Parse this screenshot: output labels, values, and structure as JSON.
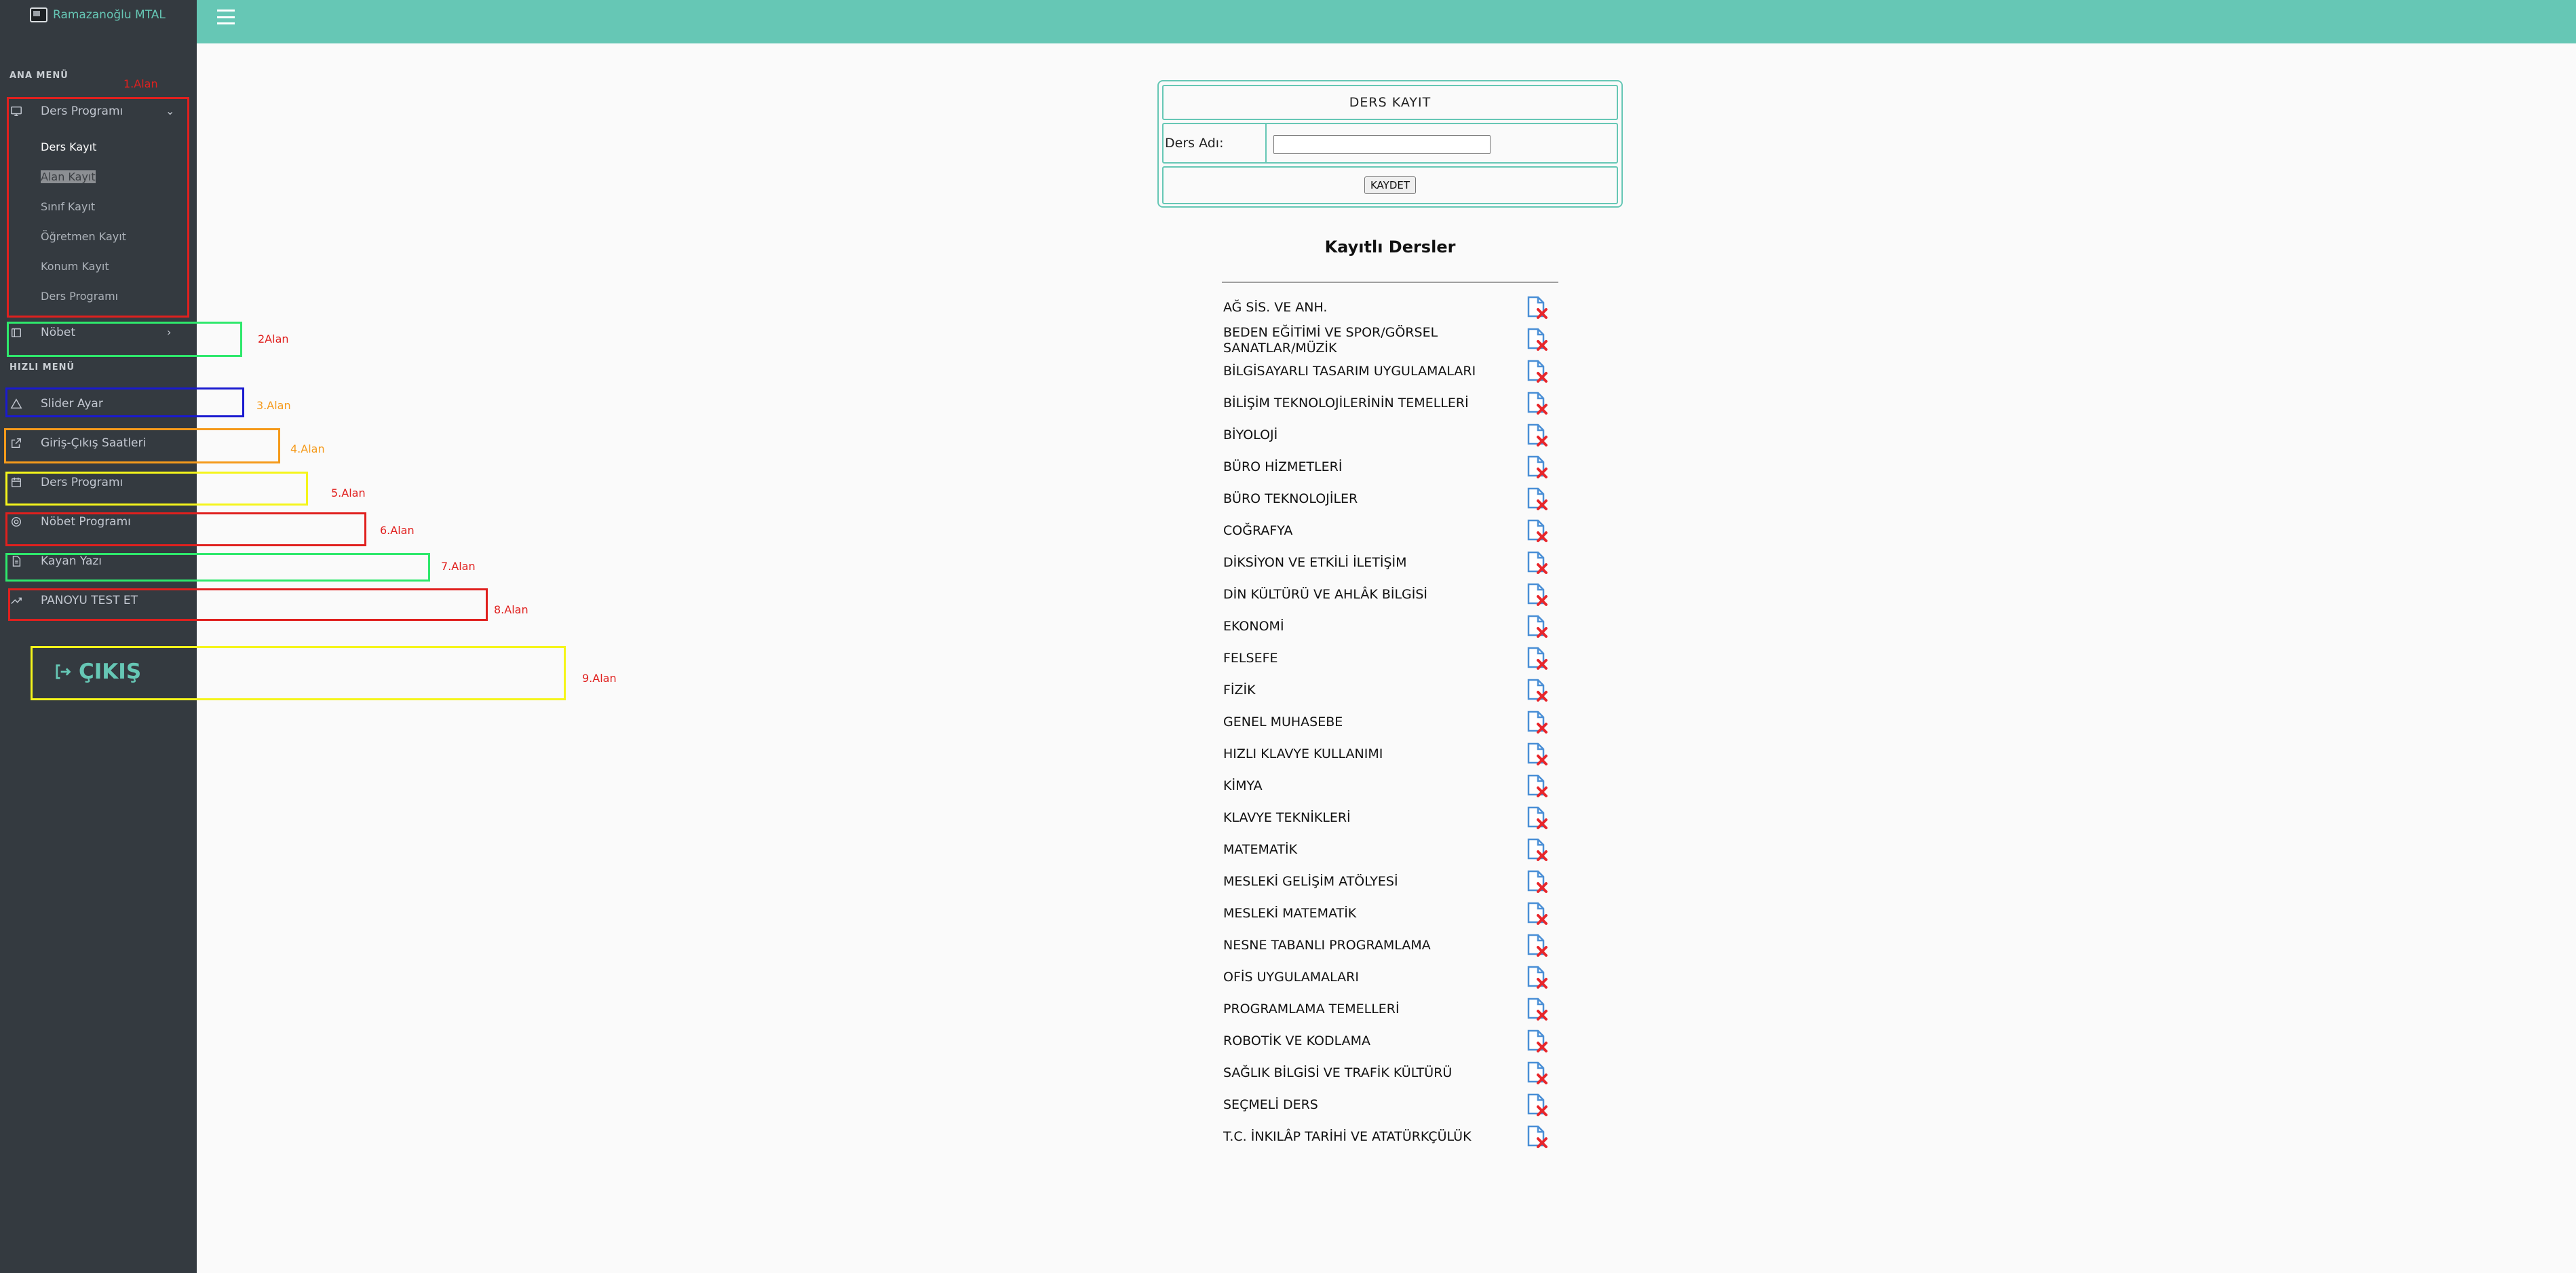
{
  "app": {
    "brand": "Ramazanoğlu MTAL"
  },
  "sidebar": {
    "main_menu_header": "ANA MENÜ",
    "quick_menu_header": "HIZLI MENÜ",
    "ders_programi": {
      "label": "Ders Programı",
      "sub_items": [
        "Ders Kayıt",
        "Alan Kayıt",
        "Sınıf Kayıt",
        "Öğretmen Kayıt",
        "Konum Kayıt",
        "Ders Programı"
      ]
    },
    "nobet": {
      "label": "Nöbet"
    },
    "quick_items": [
      "Slider Ayar",
      "Giriş-Çıkış Saatleri",
      "Ders Programı",
      "Nöbet Programı",
      "Kayan Yazı",
      "PANOYU TEST ET"
    ],
    "logout_label": "ÇIKIŞ"
  },
  "annotations": [
    {
      "label": "1.Alan",
      "color": "#e0201e"
    },
    {
      "label": "2Alan",
      "color": "#2ee86c"
    },
    {
      "label": "3.Alan",
      "color": "#1a1ad0"
    },
    {
      "label": "4.Alan",
      "color": "#f59a1b"
    },
    {
      "label": "5.Alan",
      "color": "#f5f51b"
    },
    {
      "label": "6.Alan",
      "color": "#e0201e"
    },
    {
      "label": "7.Alan",
      "color": "#2ee86c"
    },
    {
      "label": "8.Alan",
      "color": "#e0201e"
    },
    {
      "label": "9.Alan",
      "color": "#f5f51b"
    }
  ],
  "form": {
    "title": "DERS KAYIT",
    "field_label": "Ders Adı:",
    "field_value": "",
    "submit_label": "KAYDET"
  },
  "list": {
    "heading": "Kayıtlı Dersler",
    "courses": [
      "AĞ SİS. VE ANH.",
      "BEDEN EĞİTİMİ VE SPOR/GÖRSEL SANATLAR/MÜZİK",
      "BİLGİSAYARLI TASARIM UYGULAMALARI",
      "BİLİŞİM TEKNOLOJİLERİNİN TEMELLERİ",
      "BİYOLOJİ",
      "BÜRO HİZMETLERİ",
      "BÜRO TEKNOLOJİLER",
      "COĞRAFYA",
      "DİKSİYON VE ETKİLİ İLETİŞİM",
      "DİN KÜLTÜRÜ VE AHLÂK BİLGİSİ",
      "EKONOMİ",
      "FELSEFE",
      "FİZİK",
      "GENEL MUHASEBE",
      "HIZLI KLAVYE KULLANIMI",
      "KİMYA",
      "KLAVYE TEKNİKLERİ",
      "MATEMATİK",
      "MESLEKİ GELİŞİM ATÖLYESİ",
      "MESLEKİ MATEMATİK",
      "NESNE TABANLI PROGRAMLAMA",
      "OFİS UYGULAMALARI",
      "PROGRAMLAMA TEMELLERİ",
      "ROBOTİK VE KODLAMA",
      "SAĞLIK BİLGİSİ VE TRAFİK KÜLTÜRÜ",
      "SEÇMELİ DERS",
      "T.C. İNKILÂP TARİHİ VE ATATÜRKÇÜLÜK"
    ]
  },
  "colors": {
    "accent": "#66c7b5",
    "sidebar_bg": "#343a40",
    "page_bg": "#fafafa"
  },
  "icons": {
    "delete": "file-delete-icon",
    "menu": "hamburger-icon"
  }
}
